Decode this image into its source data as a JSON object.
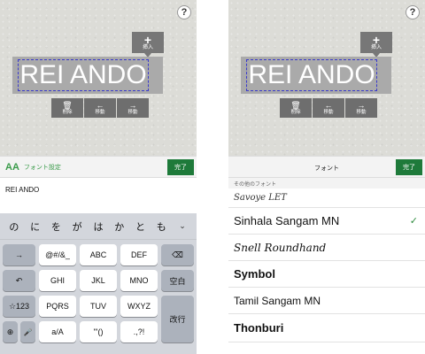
{
  "help_label": "?",
  "insert": {
    "icon": "plus-icon",
    "symbol": "+",
    "label": "挿入"
  },
  "canvas_text": "REI ANDO",
  "actions": [
    {
      "icon": "trash-icon",
      "symbol": "🗑",
      "label": "削除"
    },
    {
      "icon": "arrow-left-icon",
      "symbol": "←",
      "label": "移動"
    },
    {
      "icon": "arrow-right-icon",
      "symbol": "→",
      "label": "移動"
    }
  ],
  "left_panel": {
    "font_settings_icon": "AA",
    "font_settings_label": "フォント設定",
    "done_label": "完了",
    "text_value": "REI ANDO",
    "candidates": [
      "の",
      "に",
      "を",
      "が",
      "は",
      "か",
      "と",
      "も"
    ],
    "candidates_more": "⌄",
    "keys": {
      "arrow": "→",
      "symbols": "@#/&_",
      "abc": "ABC",
      "def": "DEF",
      "backspace": "⌫",
      "undo": "↶",
      "ghi": "GHI",
      "jkl": "JKL",
      "mno": "MNO",
      "space": "空白",
      "mode": "☆123",
      "pqrs": "PQRS",
      "tuv": "TUV",
      "wxyz": "WXYZ",
      "enter": "改行",
      "globe": "⊕",
      "mic": "🎤",
      "case": "a/A",
      "quotes": "'\"()",
      "punct": ".,?!"
    }
  },
  "right_panel": {
    "title": "フォント",
    "done_label": "完了",
    "section_header": "その他のフォント",
    "fonts": [
      "Savoye LET",
      "Sinhala Sangam MN",
      "Snell Roundhand",
      "Symbol",
      "Tamil Sangam MN",
      "Thonburi"
    ],
    "selected_index": 1,
    "check_symbol": "✓"
  },
  "colors": {
    "accent_green": "#1e7a3a",
    "selection_dash": "#3a3acc"
  }
}
